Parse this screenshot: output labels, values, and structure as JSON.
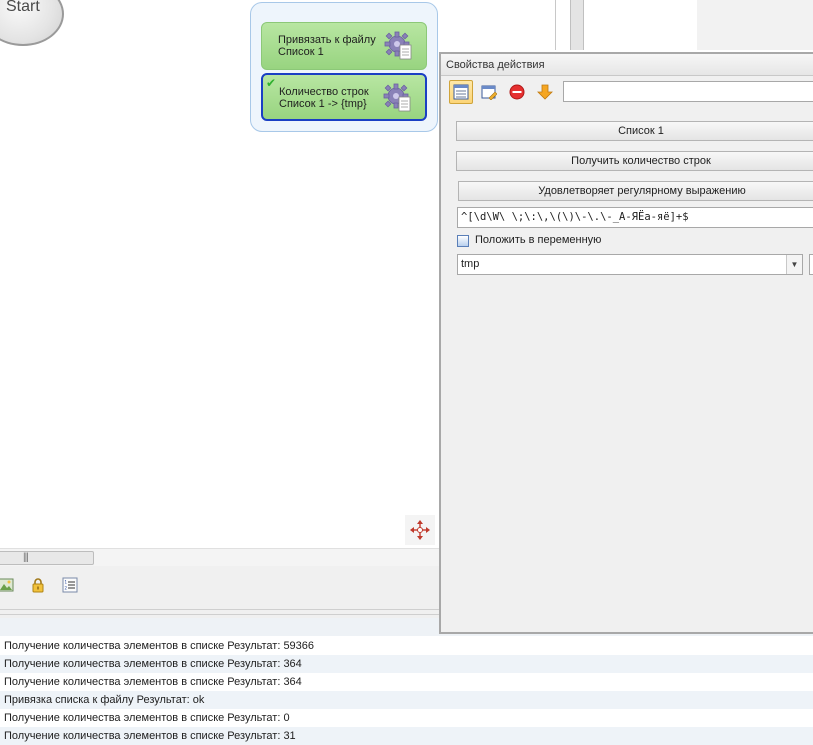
{
  "canvas": {
    "start_label": "Start",
    "nodes": [
      {
        "line1": "Привязать к файлу",
        "line2": "Список 1"
      },
      {
        "line1": "Количество строк",
        "line2": "Список 1 -> {tmp}"
      }
    ]
  },
  "properties": {
    "title": "Свойства действия",
    "search_value": "",
    "list_button": "Список 1",
    "operation_button": "Получить количество строк",
    "condition_button": "Удовлетворяет регулярному выражению",
    "regex_value": "^[\\d\\W\\ \\;\\:\\,\\(\\)\\-\\.\\-_A-ЯЁа-яё]+$",
    "checkbox_label": "Положить в переменную",
    "variable_value": "tmp"
  },
  "log": [
    "Получение количества элементов в списке  Результат: 59366",
    "Получение количества элементов в списке  Результат: 364",
    "Получение количества элементов в списке  Результат: 364",
    "Привязка списка к файлу  Результат: ok",
    "Получение количества элементов в списке  Результат: 0",
    "Получение количества элементов в списке  Результат: 31"
  ],
  "icons": {
    "node_icon": "gear-document-icon",
    "toolbar": [
      "image-icon",
      "lock-icon",
      "list-icon"
    ],
    "props_toolbar": [
      "view-icon",
      "edit-icon",
      "stop-icon",
      "arrow-down-icon"
    ],
    "canvas": [
      "move-icon"
    ]
  },
  "colors": {
    "node_fill": "#a6dc8c",
    "selected_border": "#1a3fc4",
    "group_fill": "#eef5fc"
  }
}
